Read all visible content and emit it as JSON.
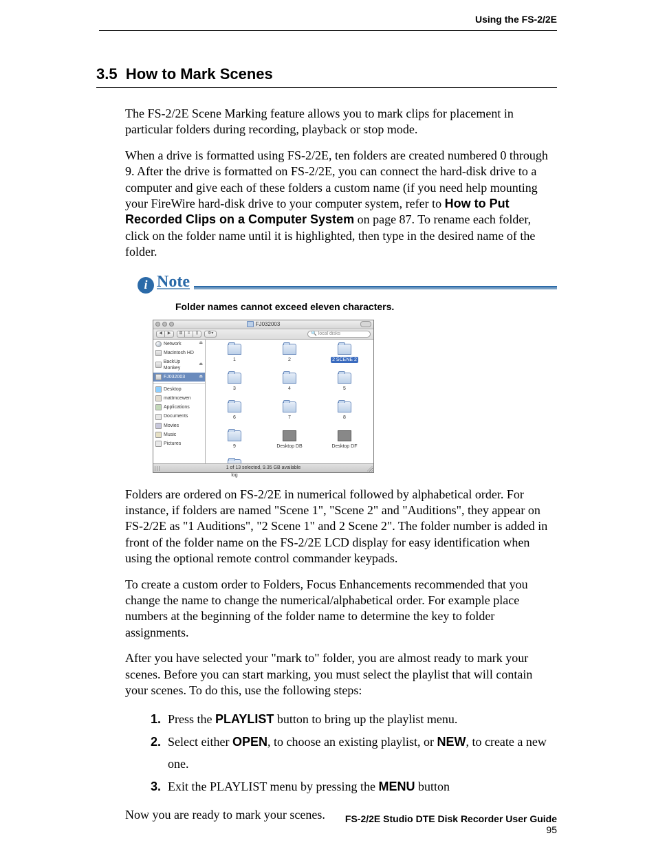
{
  "runningHead": "Using the FS-2/2E",
  "section": {
    "number": "3.5",
    "title": "How to Mark Scenes"
  },
  "para1": "The FS-2/2E Scene Marking feature allows you to mark clips for placement in particular folders during recording, playback or stop mode.",
  "para2_a": "When a drive is formatted using FS-2/2E, ten folders are created numbered 0 through 9. After the drive is formatted on FS-2/2E, you can connect the hard-disk drive to a computer and give each of these folders a custom name (if you need help mounting your FireWire hard-disk drive to your computer system, refer to ",
  "para2_xref": "How to Put Recorded Clips on a Computer System",
  "para2_b": " on page 87. To rename each folder, click on the folder name until it is highlighted, then type in the desired name of the folder.",
  "note": {
    "label": "Note",
    "caption": "Folder names cannot exceed eleven characters."
  },
  "finder": {
    "title": "FJ032003",
    "navBack": "◀",
    "navFwd": "▶",
    "viewIcons": "⊞",
    "viewList": "≡",
    "viewCol": "⫼",
    "actionGear": "⚙▾",
    "searchGlyph": "🔍",
    "searchPlaceholder": "local disks",
    "sidebar": {
      "network": "Network",
      "macHD": "Macintosh HD",
      "backup": "BackUp Monkey",
      "vol": "FJ032003",
      "desktop": "Desktop",
      "home": "mattmcewen",
      "apps": "Applications",
      "docs": "Documents",
      "movies": "Movies",
      "music": "Music",
      "pictures": "Pictures",
      "eject": "⏏"
    },
    "items": {
      "f1": "1",
      "f2": "2",
      "scene2": "2 SCENE 2",
      "f3": "3",
      "f4": "4",
      "f5": "5",
      "f6": "6",
      "f7": "7",
      "f8": "8",
      "f9": "9",
      "db1": "Desktop DB",
      "db2": "Desktop DF",
      "log": "log"
    },
    "status": "1 of 13 selected, 9.35 GB available"
  },
  "para3": "Folders are ordered on FS-2/2E in numerical followed by alphabetical order. For instance, if folders are named \"Scene 1\", \"Scene 2\" and \"Auditions\", they appear on FS-2/2E as \"1 Auditions\", \"2 Scene 1\" and 2 Scene 2\". The folder number is added in front of the folder name on the FS-2/2E LCD display for easy identification when using the optional remote control commander keypads.",
  "para4": "To create a custom order to Folders, Focus Enhancements recommended that you change the name to change the numerical/alphabetical order. For example place numbers at the beginning of the folder name to determine the key to folder assignments.",
  "para5": "After you have selected your \"mark to\" folder, you are almost ready to mark your scenes. Before you can start marking, you must select the playlist that will contain your scenes. To do this, use the following steps:",
  "steps": {
    "n1": "1.",
    "s1a": "Press the ",
    "s1b": "PLAYLIST",
    "s1c": " button to bring up the playlist menu.",
    "n2": "2.",
    "s2a": "Select either ",
    "s2b": "OPEN",
    "s2c": ", to choose an existing playlist, or ",
    "s2d": "NEW",
    "s2e": ", to create a new one.",
    "n3": "3.",
    "s3a": "Exit the PLAYLIST menu by pressing the ",
    "s3b": "MENU",
    "s3c": " button"
  },
  "para6": "Now you are ready to mark your scenes.",
  "footer": {
    "title": "FS-2/2E Studio DTE Disk Recorder User Guide",
    "page": "95"
  }
}
